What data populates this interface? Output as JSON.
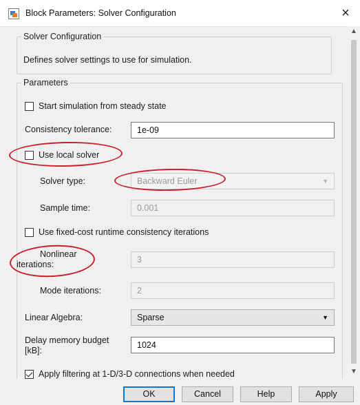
{
  "window": {
    "title": "Block Parameters: Solver Configuration",
    "close_glyph": "×"
  },
  "header": {
    "group_title": "Solver Configuration",
    "description": "Defines solver settings to use for simulation."
  },
  "parameters": {
    "group_title": "Parameters",
    "start_steady_state": {
      "label": "Start simulation from steady state",
      "checked": false
    },
    "consistency_tolerance": {
      "label": "Consistency tolerance:",
      "value": "1e-09"
    },
    "use_local_solver": {
      "label": "Use local solver",
      "checked": false
    },
    "solver_type": {
      "label": "Solver type:",
      "value": "Backward Euler"
    },
    "sample_time": {
      "label": "Sample time:",
      "value": "0.001"
    },
    "fixed_cost": {
      "label": "Use fixed-cost runtime consistency iterations",
      "checked": false
    },
    "nonlinear_iterations": {
      "label_line1": "Nonlinear",
      "label_line2": "iterations:",
      "value": "3"
    },
    "mode_iterations": {
      "label": "Mode iterations:",
      "value": "2"
    },
    "linear_algebra": {
      "label": "Linear Algebra:",
      "value": "Sparse"
    },
    "delay_memory": {
      "label_line1": "Delay memory budget",
      "label_line2": "[kB]:",
      "value": "1024"
    },
    "apply_filtering": {
      "label": "Apply filtering at 1-D/3-D connections when needed",
      "checked": true
    }
  },
  "buttons": {
    "ok": "OK",
    "cancel": "Cancel",
    "help": "Help",
    "apply": "Apply"
  },
  "colors": {
    "annotation_red": "#c8202a",
    "default_button_border": "#0078d7"
  }
}
